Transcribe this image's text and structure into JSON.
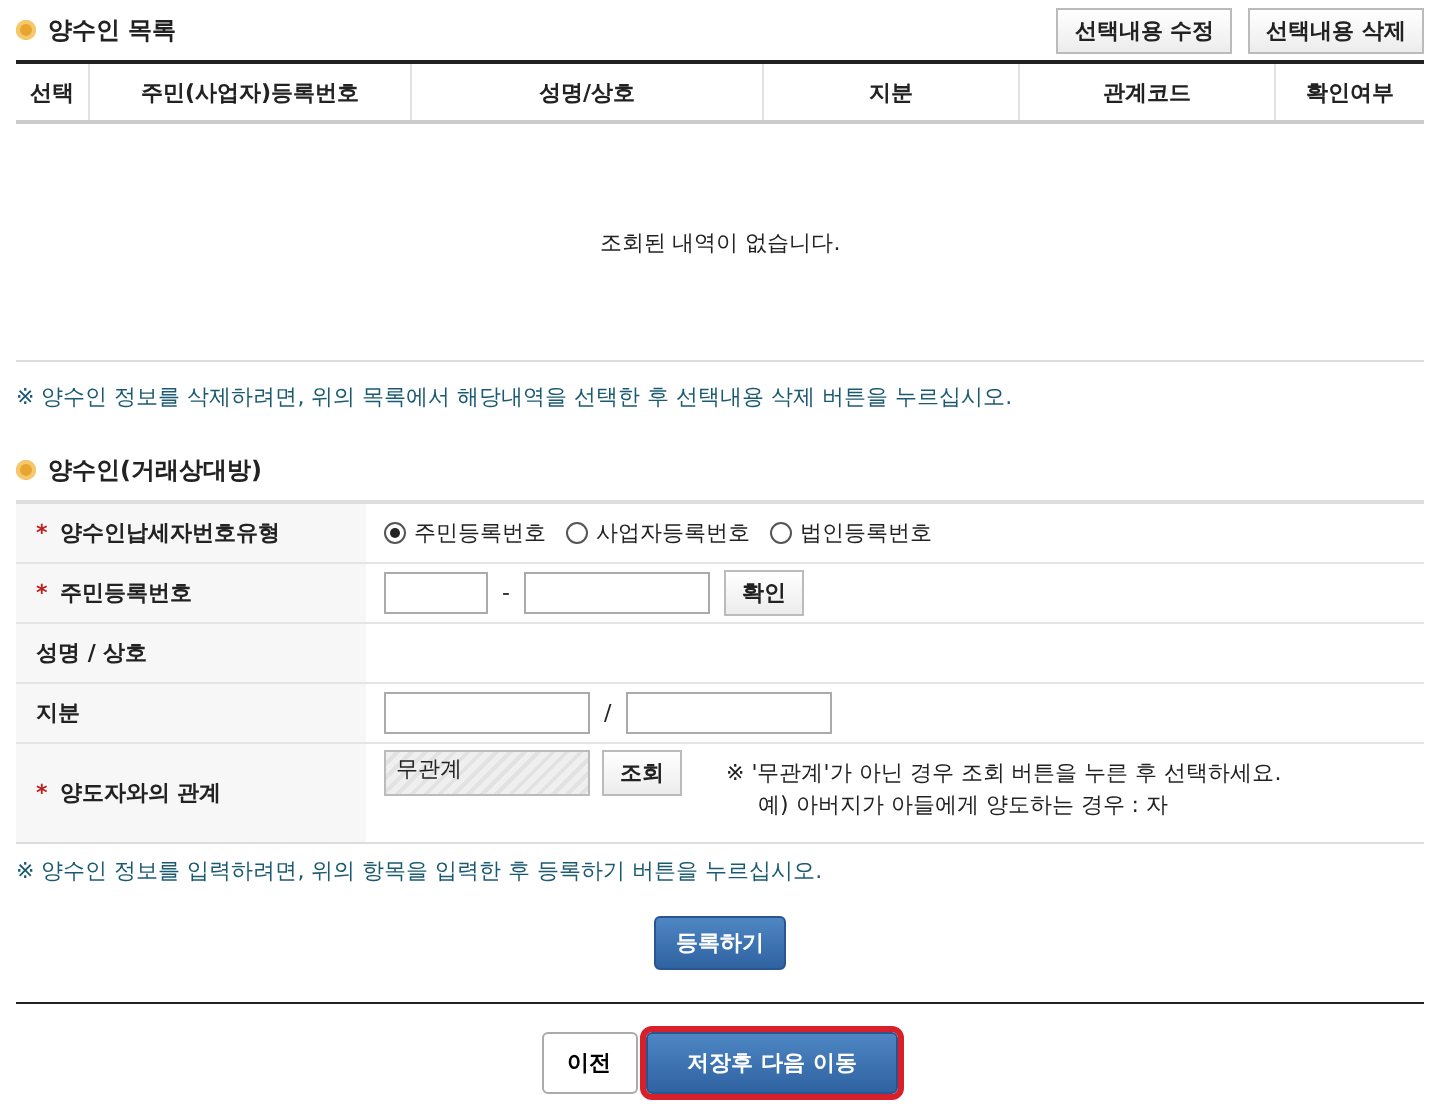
{
  "list_section": {
    "title": "양수인 목록",
    "buttons": [
      "선택내용 수정",
      "선택내용 삭제"
    ],
    "columns": [
      "선택",
      "주민(사업자)등록번호",
      "성명/상호",
      "지분",
      "관계코드",
      "확인여부"
    ],
    "empty_message": "조회된 내역이 없습니다.",
    "note": "※ 양수인 정보를 삭제하려면, 위의 목록에서 해당내역을 선택한 후 선택내용 삭제 버튼을 누르십시오."
  },
  "form_section": {
    "title": "양수인(거래상대방)",
    "required_mark": "*",
    "rows": [
      {
        "kind": "radio",
        "label": "양수인납세자번호유형",
        "required": true,
        "options": [
          {
            "label": "주민등록번호",
            "selected": true
          },
          {
            "label": "사업자등록번호",
            "selected": false
          },
          {
            "label": "법인등록번호",
            "selected": false
          }
        ]
      },
      {
        "kind": "id",
        "label": "주민등록번호",
        "required": true,
        "separator": "-",
        "button": "확인"
      },
      {
        "kind": "text",
        "label": "성명 / 상호",
        "required": false
      },
      {
        "kind": "share",
        "label": "지분",
        "required": false,
        "separator": "/"
      },
      {
        "kind": "relation",
        "label": "양도자와의 관계",
        "required": true,
        "value": "무관계",
        "readonly": true,
        "button": "조회",
        "hints": [
          "※ '무관계'가 아닌 경우 조회 버튼을 누른 후 선택하세요.",
          "예) 아버지가 아들에게 양도하는 경우 : 자"
        ]
      }
    ],
    "note": "※ 양수인 정보를 입력하려면, 위의 항목을 입력한 후 등록하기 버튼을 누르십시오.",
    "register_button": "등록하기"
  },
  "footer": {
    "buttons": [
      {
        "label": "이전",
        "kind": "plain",
        "highlighted": false
      },
      {
        "label": "저장후 다음 이동",
        "kind": "primary",
        "highlighted": true
      }
    ]
  }
}
